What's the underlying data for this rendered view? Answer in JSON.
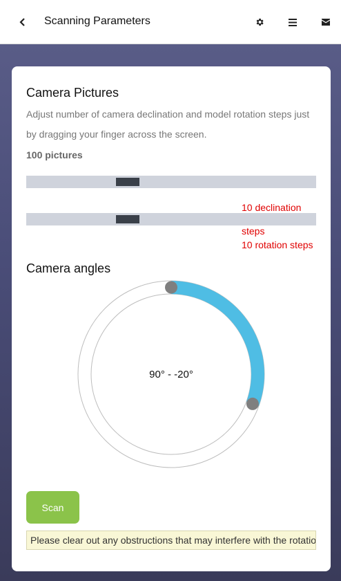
{
  "header": {
    "title": "Scanning Parameters",
    "icons": [
      "chevron-left-icon",
      "gear-icon",
      "menu-icon",
      "envelope-icon"
    ]
  },
  "pictures": {
    "heading": "Camera Pictures",
    "description": "Adjust number of camera declination and model rotation steps just by dragging your finger across the screen.",
    "count_label": "100 pictures",
    "declination_slider": {
      "value_fraction": 0.35
    },
    "rotation_slider": {
      "value_fraction": 0.35
    },
    "declination_label_a": "10 declination",
    "declination_label_b": "steps",
    "rotation_label": "10 rotation steps"
  },
  "angles": {
    "heading": "Camera angles",
    "range_label": "90° - -20°",
    "start_deg": 90,
    "end_deg": -20,
    "arc_color": "#4fbde4",
    "handle_color": "#7f7f7f"
  },
  "scan_button": {
    "label": "Scan",
    "color": "#8bc34a"
  },
  "notice": "Please clear out any obstructions that may interfere with the rotatio"
}
